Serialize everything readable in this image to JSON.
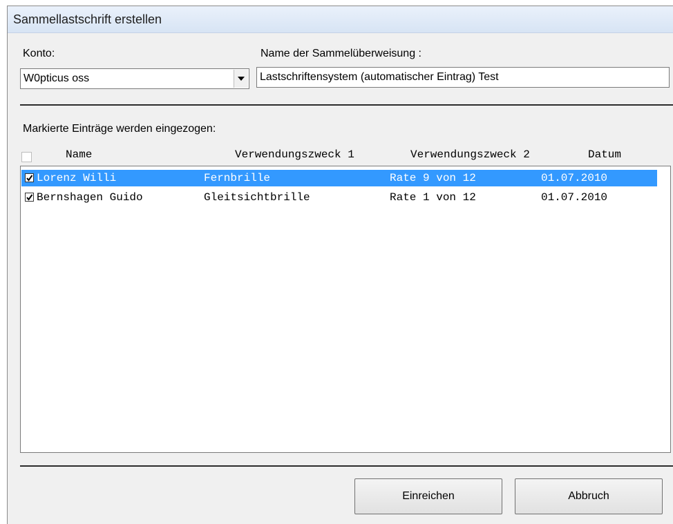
{
  "window": {
    "title": "Sammellastschrift erstellen"
  },
  "form": {
    "konto_label": "Konto:",
    "konto_value": "W0pticus oss",
    "name_label": "Name der Sammelüberweisung :",
    "name_value": "Lastschriftensystem (automatischer Eintrag) Test"
  },
  "list": {
    "caption": "Markierte Einträge werden eingezogen:",
    "columns": [
      "Name",
      "Verwendungszweck 1",
      "Verwendungszweck 2",
      "Datum"
    ],
    "rows": [
      {
        "name": "Lorenz Willi",
        "zweck1": "Fernbrille",
        "zweck2": "Rate 9 von 12",
        "datum": "01.07.2010",
        "checked": true,
        "selected": true
      },
      {
        "name": "Bernshagen Guido",
        "zweck1": "Gleitsichtbrille",
        "zweck2": "Rate 1 von 12",
        "datum": "01.07.2010",
        "checked": true,
        "selected": false
      }
    ]
  },
  "buttons": {
    "submit": "Einreichen",
    "cancel": "Abbruch"
  },
  "colors": {
    "selection": "#3399ff",
    "titlebar": "#dbe7f5",
    "dialog": "#f0f0f0"
  },
  "icons": {
    "combo_arrow": "chevron-down-icon",
    "checkmark": "checkmark-icon"
  }
}
